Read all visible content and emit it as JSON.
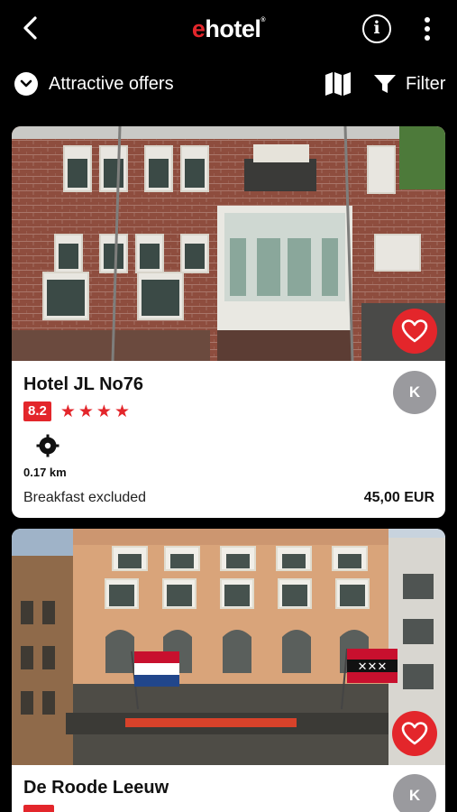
{
  "app": {
    "logo_e": "e",
    "logo_rest": "hotel",
    "logo_mark": "®"
  },
  "topbar": {
    "back_icon": "back-chevron-icon",
    "info_icon_glyph": "i",
    "more_icon": "vertical-dots-icon"
  },
  "toolbar": {
    "sort_label": "Attractive offers",
    "filter_label": "Filter"
  },
  "colors": {
    "accent": "#e3262b",
    "avatar": "#9a9a9e",
    "background": "#000000"
  },
  "hotels": [
    {
      "name": "Hotel JL No76",
      "score": "8.2",
      "stars": "★★★★",
      "star_count": 4,
      "distance": "0.17 km",
      "breakfast": "Breakfast excluded",
      "price": "45,00 EUR",
      "avatar_initial": "K"
    },
    {
      "name": "De Roode Leeuw",
      "avatar_initial": "K"
    }
  ]
}
